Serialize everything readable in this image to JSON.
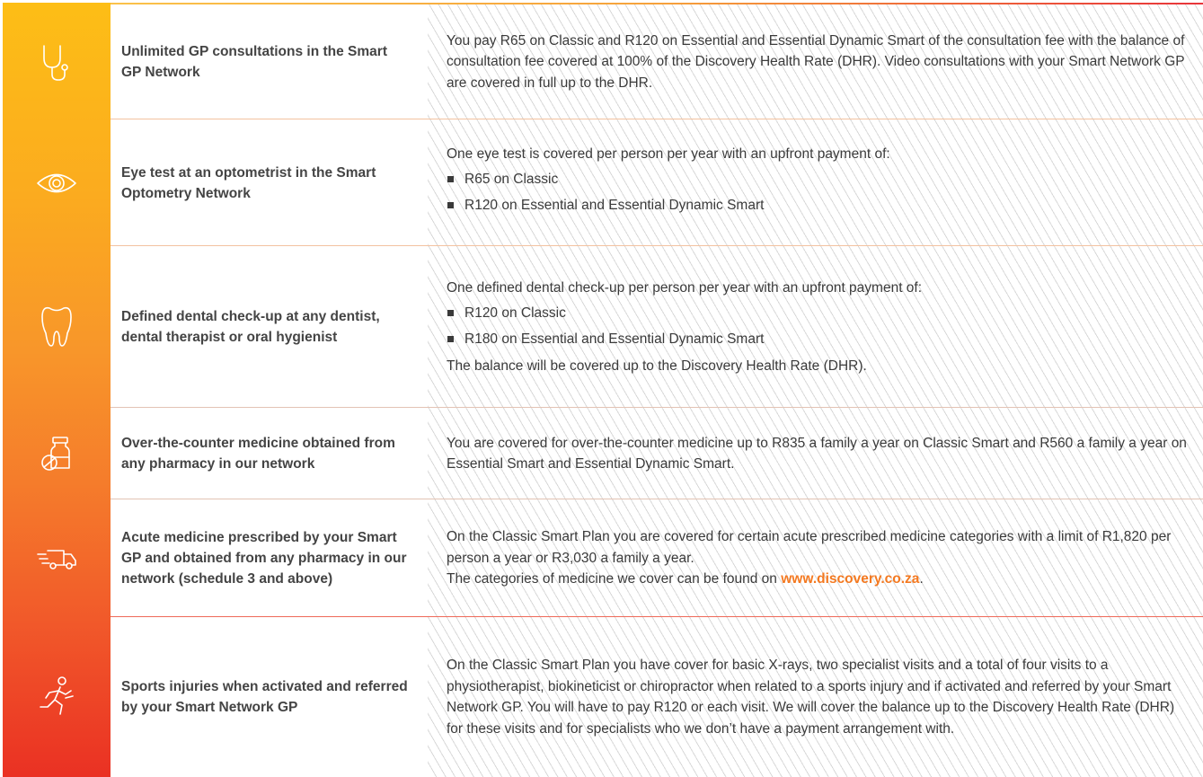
{
  "rows": [
    {
      "icon": "stethoscope-icon",
      "label": "Unlimited GP consultations in the Smart GP Network",
      "paragraphs": [
        "You pay R65 on Classic and R120 on Essential and Essential Dynamic Smart of the consultation fee with the balance of consultation fee covered at 100% of the Discovery Health Rate (DHR). Video consultations with your Smart Network GP are covered in full up to the DHR."
      ]
    },
    {
      "icon": "eye-icon",
      "label": "Eye test at an optometrist in the Smart Optometry Network",
      "intro": "One eye test is covered per person per year with an upfront payment of:",
      "bullets": [
        "R65 on Classic",
        "R120 on Essential and Essential Dynamic Smart"
      ]
    },
    {
      "icon": "tooth-icon",
      "label": "Defined dental check-up at any dentist, dental therapist or oral hygienist",
      "intro": "One defined dental check-up per person per year with an upfront payment of:",
      "bullets": [
        "R120 on Classic",
        "R180 on Essential and Essential Dynamic Smart"
      ],
      "outro": "The balance will be covered up to the Discovery Health Rate (DHR)."
    },
    {
      "icon": "pill-bottle-icon",
      "label": "Over-the-counter medicine obtained from any pharmacy in our network",
      "paragraphs": [
        "You are covered for over-the-counter medicine up to R835 a family a year on Classic Smart and R560 a family a year on Essential Smart and Essential Dynamic Smart."
      ]
    },
    {
      "icon": "delivery-van-icon",
      "label": "Acute medicine prescribed by your Smart GP and obtained from any pharmacy in our network (schedule 3 and above)",
      "paragraphs": [
        "On the Classic Smart Plan you are covered for certain acute prescribed medicine categories with a limit of R1,820 per person a year or R3,030 a family a year."
      ],
      "link_prefix": "The categories of medicine we cover can be found on ",
      "link_text": "www.discovery.co.za",
      "link_suffix": "."
    },
    {
      "icon": "runner-icon",
      "label": "Sports injuries when activated and referred by your Smart Network GP",
      "paragraphs": [
        "On the Classic Smart Plan you have cover for basic X-rays, two specialist visits and a total of four visits to a physiotherapist, biokineticist or chiropractor when related to a sports injury and if activated and referred by your Smart Network GP. You will have to pay R120 or each visit. We will cover the balance up to the Discovery Health Rate (DHR) for these visits and for specialists who we don’t have a payment arrangement with."
      ]
    }
  ]
}
